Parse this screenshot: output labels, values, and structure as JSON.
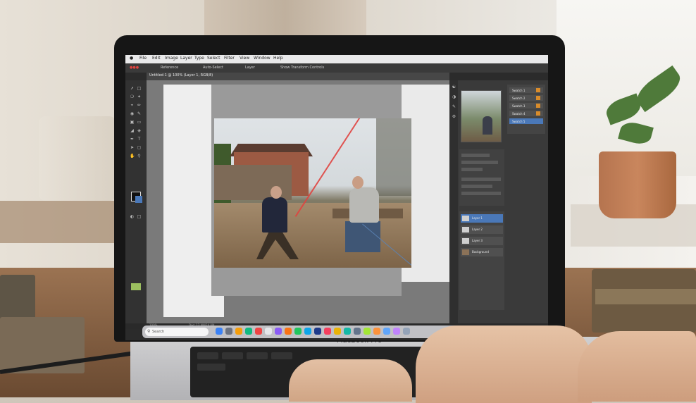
{
  "menubar": {
    "items": [
      "File",
      "Edit",
      "Image",
      "Layer",
      "Type",
      "Select",
      "Filter",
      "View",
      "Window",
      "Help"
    ]
  },
  "optionsbar": {
    "items": [
      "Reference",
      "Auto-Select",
      "Layer",
      "Show Transform Controls"
    ]
  },
  "document": {
    "tab": "Untitled-1 @ 100% (Layer 1, RGB/8)"
  },
  "layers": {
    "rows": [
      "Layer 1",
      "Layer 2",
      "Layer 3",
      "Background"
    ]
  },
  "swatches": {
    "rows": [
      "Swatch 1",
      "Swatch 2",
      "Swatch 3",
      "Swatch 4",
      "Swatch 5"
    ]
  },
  "status": {
    "left": "100%",
    "right": "Doc: 12.4M/24.8M"
  },
  "dock": {
    "search_placeholder": "Search"
  },
  "laptop": {
    "brand": "MacBook Pro"
  },
  "colors": {
    "selection_blue": "#4a78b8",
    "guide_red": "#e0433f",
    "guide_blue": "#5b83b5",
    "swatch_orange": "#d98c2b"
  },
  "icons": [
    "tool-icon",
    "gear-icon",
    "search-icon",
    "layer-thumbnail-icon",
    "eye-icon"
  ]
}
